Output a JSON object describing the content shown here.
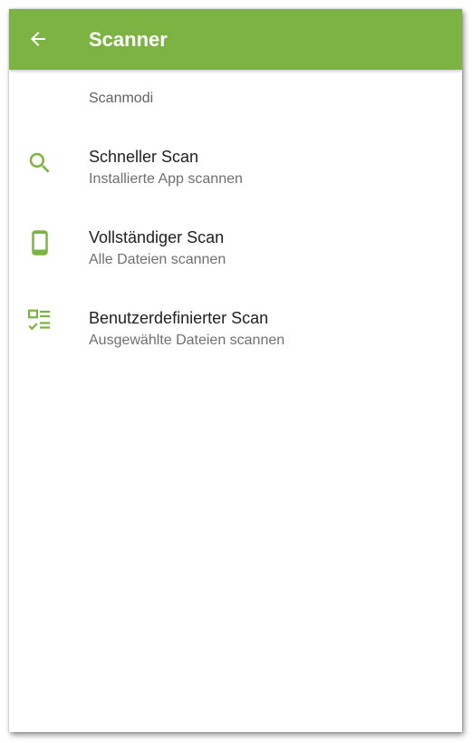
{
  "appbar": {
    "title": "Scanner",
    "back_icon": "arrow-back-icon",
    "color": "#7cb342"
  },
  "section": {
    "header": "Scanmodi"
  },
  "items": [
    {
      "title": "Schneller Scan",
      "subtitle": "Installierte App scannen",
      "icon": "search-icon"
    },
    {
      "title": "Vollständiger Scan",
      "subtitle": "Alle Dateien scannen",
      "icon": "smartphone-icon"
    },
    {
      "title": "Benutzerdefinierter Scan",
      "subtitle": "Ausgewählte Dateien scannen",
      "icon": "custom-checklist-icon"
    }
  ],
  "colors": {
    "accent": "#7cb342",
    "title_text": "#212121",
    "subtitle_text": "#6f6f6f"
  }
}
